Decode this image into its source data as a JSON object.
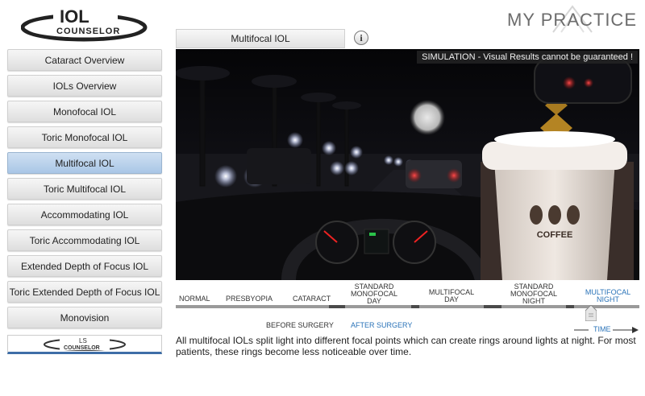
{
  "header": {
    "logo_text": "IOL COUNSELOR",
    "brand_text": "MY PRACTICE"
  },
  "sidebar": {
    "items": [
      {
        "label": "Cataract Overview",
        "active": false
      },
      {
        "label": "IOLs Overview",
        "active": false
      },
      {
        "label": "Monofocal IOL",
        "active": false
      },
      {
        "label": "Toric Monofocal IOL",
        "active": false
      },
      {
        "label": "Multifocal IOL",
        "active": true
      },
      {
        "label": "Toric Multifocal IOL",
        "active": false
      },
      {
        "label": "Accommodating IOL",
        "active": false
      },
      {
        "label": "Toric Accommodating IOL",
        "active": false
      },
      {
        "label": "Extended Depth of Focus IOL",
        "active": false
      },
      {
        "label": "Toric Extended Depth of Focus IOL",
        "active": false
      },
      {
        "label": "Monovision",
        "active": false
      }
    ],
    "footer_logo_text": "LS COUNSELOR"
  },
  "content": {
    "title": "Multifocal IOL",
    "info_icon": "i",
    "simulation_notice": "SIMULATION - Visual Results cannot be guaranteed !",
    "cup_label": "COFFEE",
    "timeline": {
      "stages": [
        {
          "label": "NORMAL"
        },
        {
          "label": "PRESBYOPIA"
        },
        {
          "label": "CATARACT"
        },
        {
          "label": "STANDARD\nMONOFOCAL\nDAY"
        },
        {
          "label": "MULTIFOCAL\nDAY"
        },
        {
          "label": "STANDARD\nMONOFOCAL\nNIGHT"
        },
        {
          "label": "MULTIFOCAL\nNIGHT"
        }
      ],
      "selected": "MULTIFOCAL NIGHT",
      "before_label": "BEFORE SURGERY",
      "after_label": "AFTER SURGERY",
      "time_label": "TIME"
    },
    "description": "All multifocal IOLs split light into different focal points which can create rings around lights at night. For most patients, these rings become less noticeable over time."
  },
  "colors": {
    "accent_blue": "#2a73b8",
    "active_item": "#b7cfea",
    "footer_rule": "#3e6ea7"
  }
}
